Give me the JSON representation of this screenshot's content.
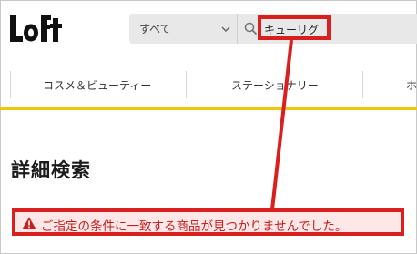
{
  "logo": {
    "text": "LoFt"
  },
  "search": {
    "category": "すべて",
    "query": "キューリグ"
  },
  "nav": {
    "items": [
      "コスメ＆ビューティー",
      "ステーショナリー",
      "ホ"
    ]
  },
  "page": {
    "title": "詳細検索",
    "alert": "ご指定の条件に一致する商品が見つかりませんでした。"
  },
  "colors": {
    "accent_yellow": "#f2c60b",
    "annotation_red": "#d9201f",
    "alert_bg": "#fde7e7",
    "alert_text": "#c61f1f"
  }
}
